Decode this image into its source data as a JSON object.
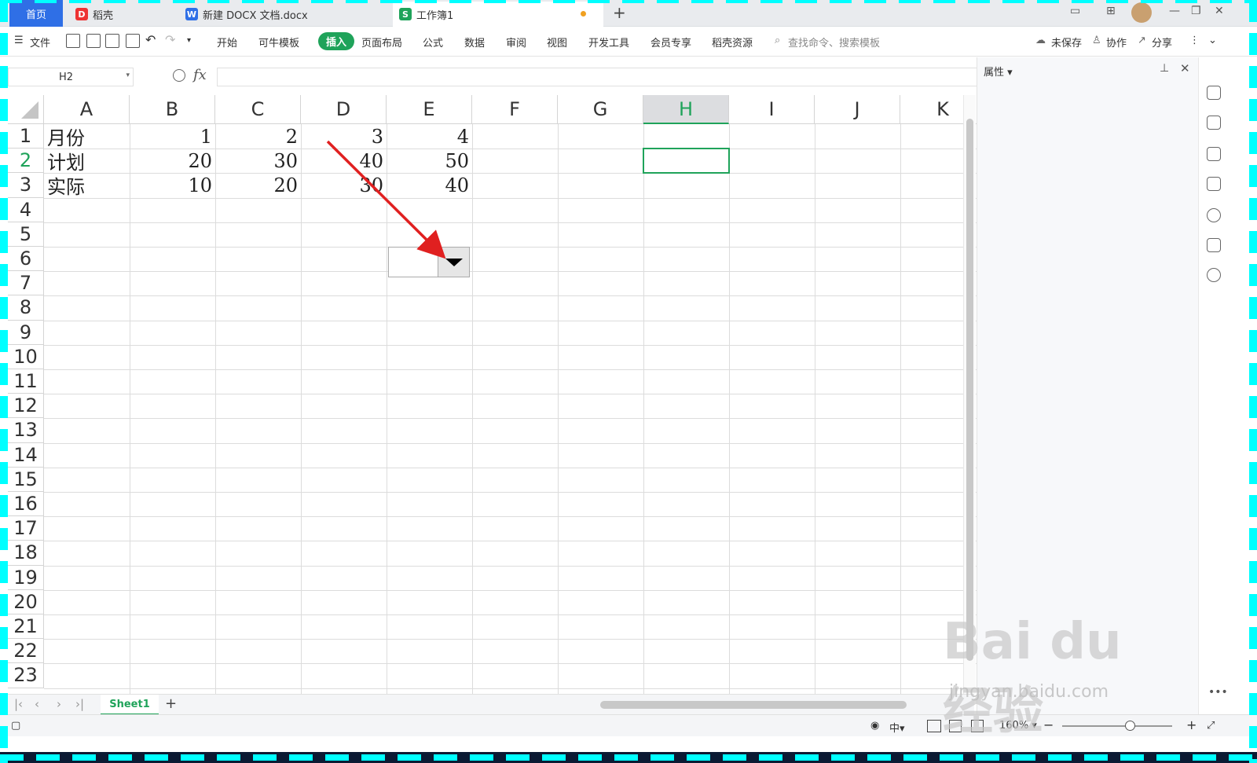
{
  "tabs": {
    "home": "首页",
    "daoke": "稻壳",
    "doc": "新建 DOCX 文档.docx",
    "book": "工作簿1"
  },
  "ribbon": {
    "file": "文件",
    "start": "开始",
    "kaniu": "可牛模板",
    "insert": "插入",
    "layout": "页面布局",
    "formula": "公式",
    "data": "数据",
    "review": "审阅",
    "view": "视图",
    "dev": "开发工具",
    "member": "会员专享",
    "resources": "稻壳资源",
    "search_placeholder": "查找命令、搜索模板",
    "unsaved": "未保存",
    "collab": "协作",
    "share": "分享"
  },
  "formula_bar": {
    "cell_ref": "H2",
    "fx": "fx",
    "value": ""
  },
  "panel": {
    "title": "属性"
  },
  "columns": [
    "A",
    "B",
    "C",
    "D",
    "E",
    "F",
    "G",
    "H",
    "I",
    "J",
    "K"
  ],
  "selected_column": "H",
  "rows": [
    "1",
    "2",
    "3",
    "4",
    "5",
    "6",
    "7",
    "8",
    "9",
    "10",
    "11",
    "12",
    "13",
    "14",
    "15",
    "16",
    "17",
    "18",
    "19",
    "20",
    "21",
    "22",
    "23"
  ],
  "selected_row": "2",
  "cells": {
    "A1": "月份",
    "B1": "1",
    "C1": "2",
    "D1": "3",
    "E1": "4",
    "A2": "计划",
    "B2": "20",
    "C2": "30",
    "D2": "40",
    "E2": "50",
    "A3": "实际",
    "B3": "10",
    "C3": "20",
    "D3": "30",
    "E3": "40"
  },
  "sheet": {
    "name": "Sheet1"
  },
  "status": {
    "zoom": "160%"
  },
  "watermark": {
    "main": "Bai du 经验",
    "sub": "jingyan.baidu.com"
  },
  "colors": {
    "accent": "#1fa35a",
    "home_tab": "#2f6fe6",
    "arrow": "#e02020"
  }
}
